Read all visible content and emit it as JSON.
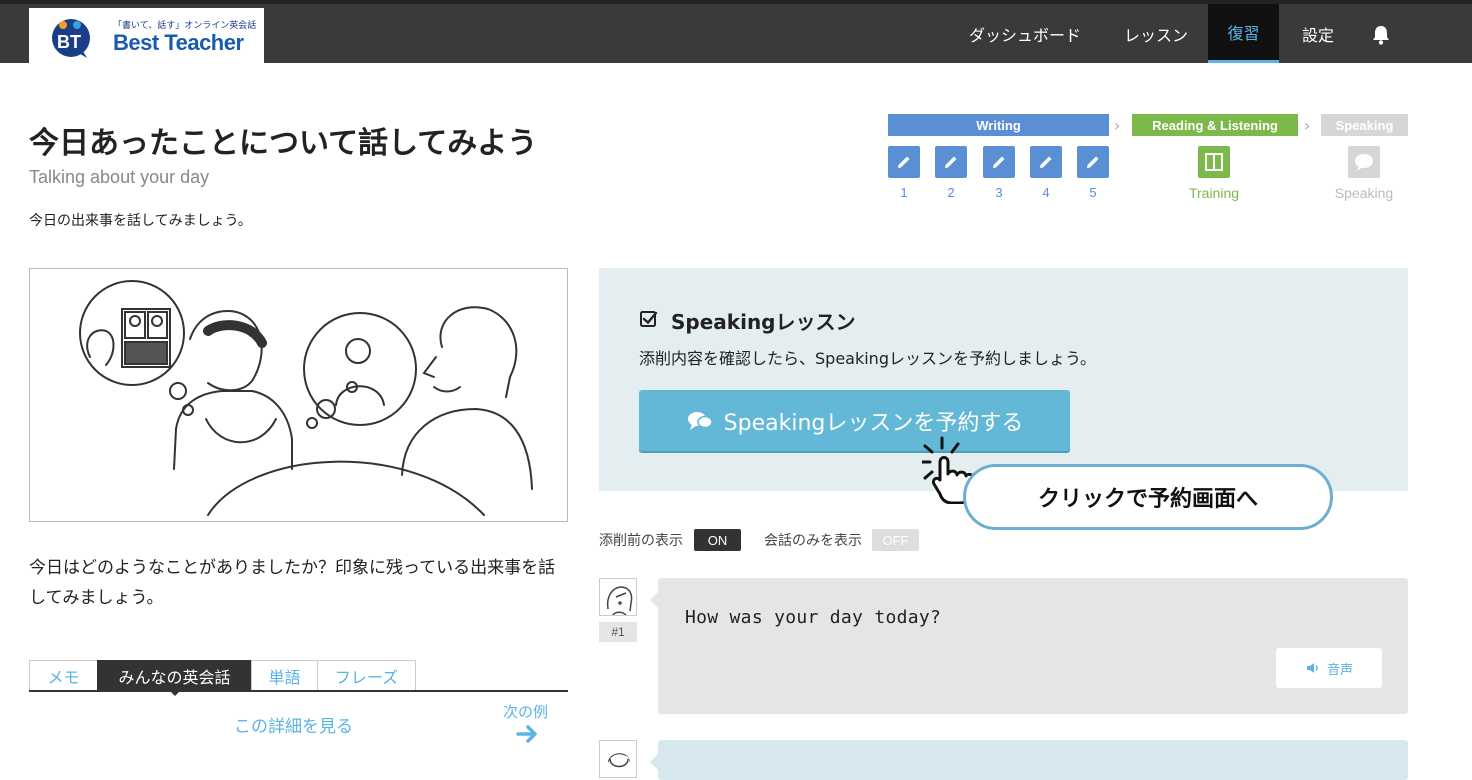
{
  "header": {
    "logo": {
      "tagline": "「書いて、話す」オンライン英会話",
      "name": "Best Teacher",
      "badge": "BT"
    },
    "nav": [
      {
        "label": "ダッシュボード",
        "active": false
      },
      {
        "label": "レッスン",
        "active": false
      },
      {
        "label": "復習",
        "active": true
      },
      {
        "label": "設定",
        "active": false
      }
    ],
    "bell_icon": "bell-icon"
  },
  "page": {
    "title": "今日あったことについて話してみよう",
    "subtitle": "Talking about your day",
    "intro": "今日の出来事を話してみましょう。",
    "question": "今日はどのようなことがありましたか？印象に残っている出来事を話してみましょう。"
  },
  "progress": {
    "writing_label": "Writing",
    "reading_label": "Reading & Listening",
    "speaking_label": "Speaking",
    "writing_steps": [
      "1",
      "2",
      "3",
      "4",
      "5"
    ],
    "training_label": "Training",
    "speaking_step_label": "Speaking",
    "colors": {
      "writing": "#5a8fd6",
      "reading": "#7db84a",
      "speaking": "#d6d6d6"
    }
  },
  "tabs": {
    "items": [
      "メモ",
      "みんなの英会話",
      "単語",
      "フレーズ"
    ],
    "active_index": 1,
    "detail_link": "この詳細を見る",
    "next_link": "次の例"
  },
  "promo": {
    "title": "Speakingレッスン",
    "text": "添削内容を確認したら、Speakingレッスンを予約しましょう。",
    "cta_label": "Speakingレッスンを予約する",
    "callout": "クリックで予約画面へ",
    "accent": "#62b8d6"
  },
  "toggles": {
    "before_label": "添削前の表示",
    "before_state": "ON",
    "conversation_label": "会話のみを表示",
    "conversation_state": "OFF"
  },
  "messages": [
    {
      "number": "#1",
      "text": "How was your day today?",
      "audio_label": "音声"
    }
  ]
}
